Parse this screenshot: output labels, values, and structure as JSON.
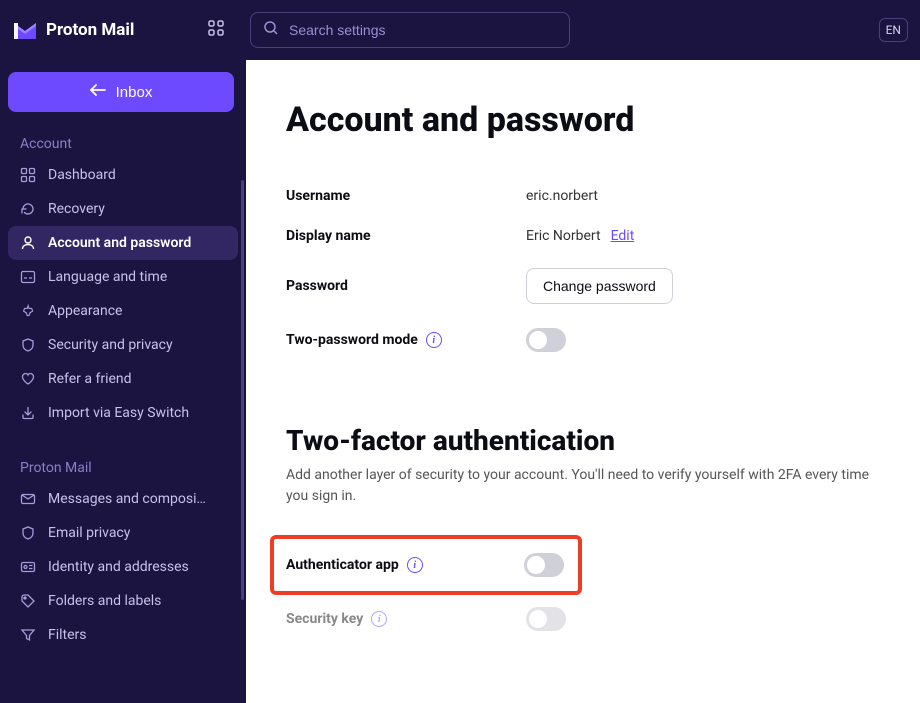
{
  "header": {
    "brand": "Proton Mail",
    "search_placeholder": "Search settings",
    "lang": "EN"
  },
  "sidebar": {
    "inbox_label": "Inbox",
    "sections": {
      "account": {
        "title": "Account",
        "items": [
          {
            "label": "Dashboard",
            "icon": "dashboard"
          },
          {
            "label": "Recovery",
            "icon": "recovery"
          },
          {
            "label": "Account and password",
            "icon": "user",
            "active": true
          },
          {
            "label": "Language and time",
            "icon": "language"
          },
          {
            "label": "Appearance",
            "icon": "appearance"
          },
          {
            "label": "Security and privacy",
            "icon": "shield"
          },
          {
            "label": "Refer a friend",
            "icon": "heart"
          },
          {
            "label": "Import via Easy Switch",
            "icon": "import"
          }
        ]
      },
      "mail": {
        "title": "Proton Mail",
        "items": [
          {
            "label": "Messages and composi…",
            "icon": "messages"
          },
          {
            "label": "Email privacy",
            "icon": "shield"
          },
          {
            "label": "Identity and addresses",
            "icon": "identity"
          },
          {
            "label": "Folders and labels",
            "icon": "tag"
          },
          {
            "label": "Filters",
            "icon": "filter"
          }
        ]
      }
    }
  },
  "main": {
    "title": "Account and password",
    "username": {
      "label": "Username",
      "value": "eric.norbert"
    },
    "display_name": {
      "label": "Display name",
      "value": "Eric Norbert",
      "edit": "Edit"
    },
    "password": {
      "label": "Password",
      "button": "Change password"
    },
    "two_password": {
      "label": "Two-password mode"
    },
    "twofa": {
      "title": "Two-factor authentication",
      "desc": "Add another layer of security to your account. You'll need to verify yourself with 2FA every time you sign in.",
      "authenticator": {
        "label": "Authenticator app"
      },
      "security_key": {
        "label": "Security key"
      }
    }
  }
}
